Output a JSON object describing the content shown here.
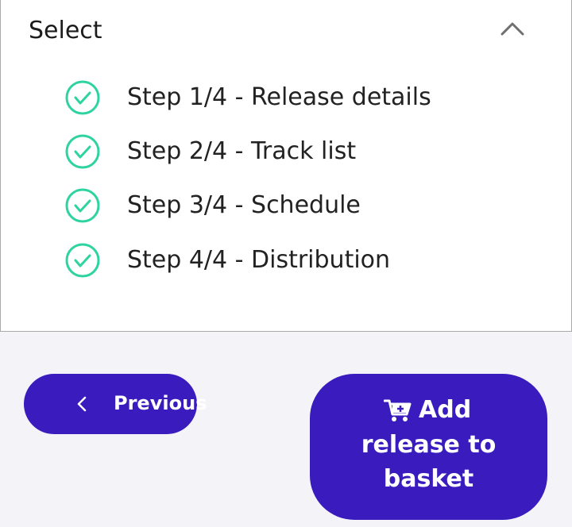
{
  "select": {
    "title": "Select",
    "steps": [
      {
        "label": "Step 1/4 - Release details",
        "status": "complete"
      },
      {
        "label": "Step 2/4 - Track list",
        "status": "complete"
      },
      {
        "label": "Step 3/4 - Schedule",
        "status": "complete"
      },
      {
        "label": "Step 4/4 - Distribution",
        "status": "complete"
      }
    ],
    "icons": {
      "collapse": "chevron-up-icon",
      "step": "check-circle-icon"
    }
  },
  "actions": {
    "previous_label": "Previous",
    "add_label_line1": "Add",
    "add_label_line2": "release to",
    "add_label_line3": "basket",
    "icons": {
      "previous": "chevron-left-icon",
      "add": "cart-plus-icon"
    }
  },
  "colors": {
    "accent": "#3a1cbe",
    "check": "#2ed3a0",
    "background": "#f4f3f8"
  }
}
